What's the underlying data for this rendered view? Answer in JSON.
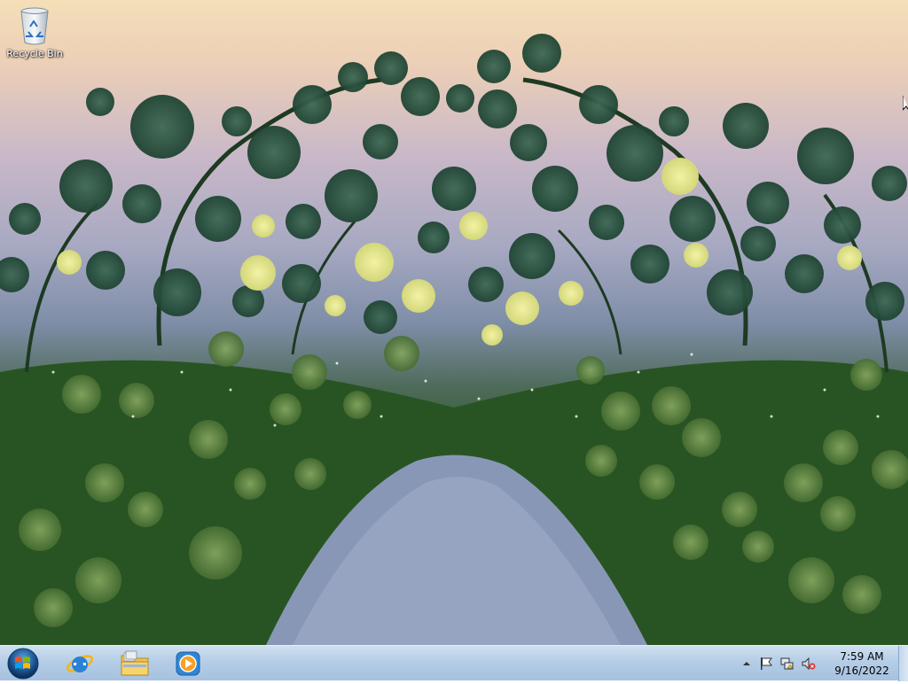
{
  "desktop": {
    "icons": [
      {
        "label": "Recycle Bin",
        "icon": "recycle-bin-icon"
      }
    ]
  },
  "taskbar": {
    "start_icon": "windows-logo-icon",
    "pinned": [
      {
        "name": "internet-explorer",
        "icon": "internet-explorer-icon"
      },
      {
        "name": "windows-explorer",
        "icon": "folder-icon"
      },
      {
        "name": "windows-media-player",
        "icon": "media-player-icon"
      }
    ],
    "tray": {
      "icons": [
        "show-hidden-icons-arrow",
        "action-center-flag-icon",
        "network-icon",
        "volume-muted-icon"
      ],
      "time": "7:59 AM",
      "date": "9/16/2022"
    }
  },
  "colors": {
    "taskbar": "#b5cde6",
    "sky_top": "#f4dfb8",
    "foliage": "#2f5a2c"
  }
}
